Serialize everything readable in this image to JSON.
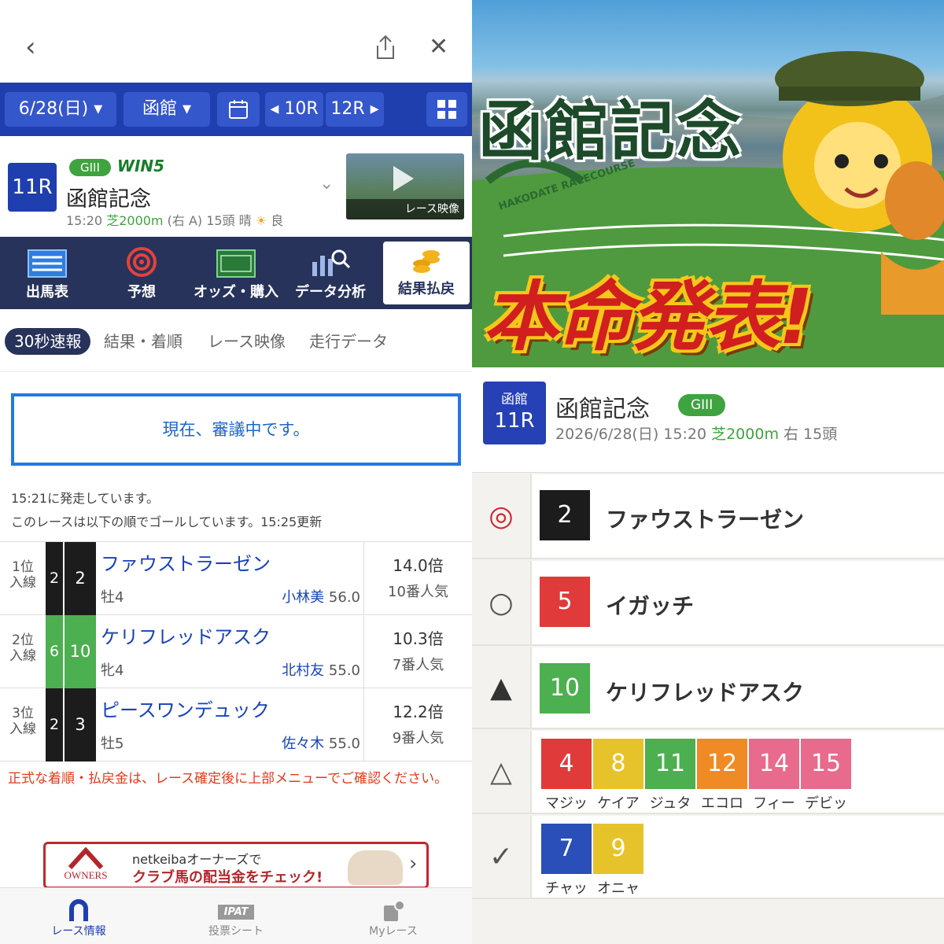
{
  "nav": {
    "back_icon": "chevron-left-icon",
    "share_icon": "share-icon",
    "close_icon": "close-icon"
  },
  "datebar": {
    "date": "6/28(日)",
    "venue": "函館",
    "prev_race": "10R",
    "next_race": "12R"
  },
  "race": {
    "number": "11R",
    "grade": "GIII",
    "win5": "WIN5",
    "name": "函館記念",
    "time": "15:20",
    "course": "芝2000m",
    "course_detail": "(右 A) 15頭 晴",
    "going": "良",
    "video_label": "レース映像"
  },
  "menu": [
    {
      "label": "出馬表",
      "icon": "list-table-icon"
    },
    {
      "label": "予想",
      "icon": "target-icon"
    },
    {
      "label": "オッズ・購入",
      "icon": "ipat-odds-icon"
    },
    {
      "label": "データ分析",
      "icon": "bar-chart-search-icon"
    },
    {
      "label": "結果払戻",
      "icon": "coins-icon"
    }
  ],
  "subtabs": [
    "30秒速報",
    "結果・着順",
    "レース映像",
    "走行データ"
  ],
  "notice": "現在、審議中です。",
  "info_line1": "15:21に発走しています。",
  "info_line2": "このレースは以下の順でゴールしています。15:25更新",
  "results": [
    {
      "pos1": "1位",
      "pos2": "入線",
      "waku": "2",
      "num": "2",
      "name": "ファウストラーゼン",
      "sex": "牡4",
      "jockey": "小林美",
      "weight": "56.0",
      "odds": "14.0倍",
      "pop": "10番人気",
      "waku_color": "#1c1c1c"
    },
    {
      "pos1": "2位",
      "pos2": "入線",
      "waku": "6",
      "num": "10",
      "name": "ケリフレッドアスク",
      "sex": "牝4",
      "jockey": "北村友",
      "weight": "55.0",
      "odds": "10.3倍",
      "pop": "7番人気",
      "waku_color": "#4caf50"
    },
    {
      "pos1": "3位",
      "pos2": "入線",
      "waku": "2",
      "num": "3",
      "name": "ピースワンデュック",
      "sex": "牡5",
      "jockey": "佐々木",
      "weight": "55.0",
      "odds": "12.2倍",
      "pop": "9番人気",
      "waku_color": "#1c1c1c"
    }
  ],
  "warning": "正式な着順・払戻金は、レース確定後に上部メニューでご確認ください。",
  "banner": {
    "logo": "OWNERS",
    "line1": "netkeibaオーナーズで",
    "line2": "クラブ馬の配当金をチェック!"
  },
  "bottom_nav": [
    {
      "label": "レース情報",
      "icon": "horseshoe-icon"
    },
    {
      "label": "投票シート",
      "icon": "ipat-icon"
    },
    {
      "label": "Myレース",
      "icon": "my-race-icon"
    }
  ],
  "bottom_ipat": "IPAT",
  "hero": {
    "title": "函館記念",
    "subtitle": "本命発表!",
    "arch": "HAKODATE RACECOURSE"
  },
  "right_race": {
    "venue": "函館",
    "number": "11R",
    "name": "函館記念",
    "grade": "GIII",
    "datetime": "2026/6/28(日) 15:20",
    "course": "芝2000m",
    "detail": "右 15頭"
  },
  "predictions": {
    "honmei": {
      "mark": "◎",
      "num": "2",
      "name": "ファウストラーゼン",
      "color": "#1c1c1c"
    },
    "taikou": {
      "mark": "○",
      "num": "5",
      "name": "イガッチ",
      "color": "#e03a3a"
    },
    "tanana": {
      "mark": "▲",
      "num": "10",
      "name": "ケリフレッドアスク",
      "color": "#4caf50"
    },
    "renka": {
      "mark": "△",
      "chips": [
        {
          "num": "4",
          "label": "マジッ",
          "color": "#e03a3a"
        },
        {
          "num": "8",
          "label": "ケイア",
          "color": "#e6c32a"
        },
        {
          "num": "11",
          "label": "ジュタ",
          "color": "#4caf50"
        },
        {
          "num": "12",
          "label": "エコロ",
          "color": "#f08a24"
        },
        {
          "num": "14",
          "label": "フィー",
          "color": "#e86a8c"
        },
        {
          "num": "15",
          "label": "デビッ",
          "color": "#e86a8c"
        }
      ]
    },
    "check": {
      "mark": "✓",
      "chips": [
        {
          "num": "7",
          "label": "チャッ",
          "color": "#2a4fb8"
        },
        {
          "num": "9",
          "label": "オニャ",
          "color": "#e6c32a"
        }
      ]
    }
  }
}
